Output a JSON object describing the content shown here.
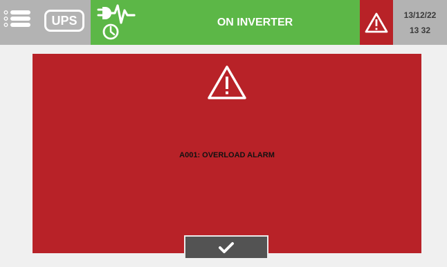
{
  "topbar": {
    "menu_icon": "menu-list-icon",
    "ups_label": "UPS",
    "status_icon": "inverter-power-clock-icon",
    "status_text": "ON INVERTER",
    "status_color": "#5cb747",
    "alarm_icon": "warning-triangle-icon",
    "alarm_color": "#b82227",
    "date": "13/12/22",
    "time": "13 32"
  },
  "alarm_panel": {
    "icon": "warning-triangle-icon",
    "message": "A001: OVERLOAD ALARM",
    "background": "#b82228",
    "ack_icon": "checkmark-icon"
  }
}
